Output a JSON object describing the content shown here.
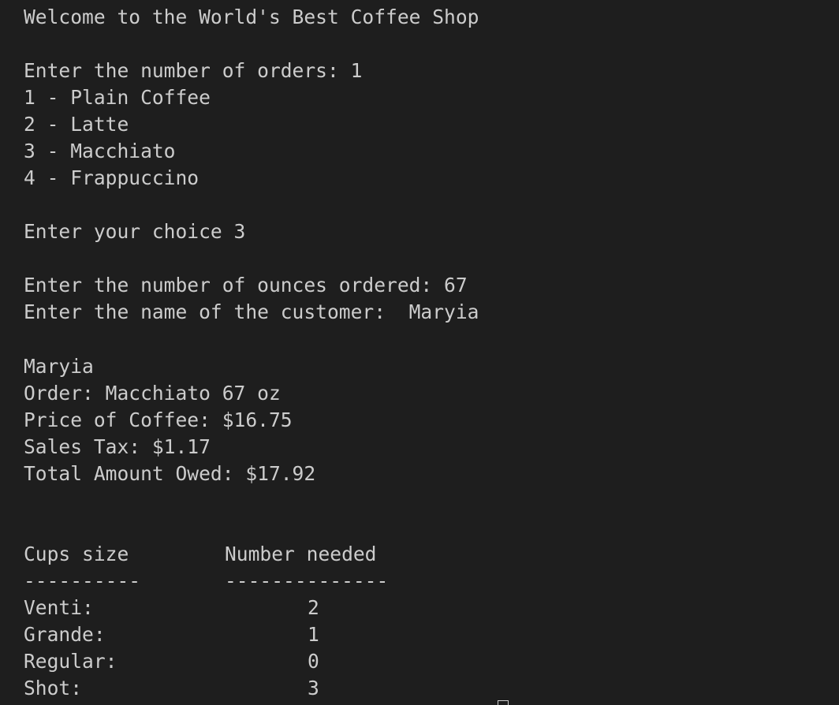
{
  "terminal": {
    "welcome": "Welcome to the World's Best Coffee Shop",
    "prompt_orders": "Enter the number of orders: 1",
    "menu": [
      "1 - Plain Coffee",
      "2 - Latte",
      "3 - Macchiato",
      "4 - Frappuccino"
    ],
    "prompt_choice": "Enter your choice 3",
    "prompt_ounces": "Enter the number of ounces ordered: 67",
    "prompt_customer": "Enter the name of the customer:  Maryia",
    "receipt": {
      "customer": "Maryia",
      "order": "Order: Macchiato 67 oz",
      "price": "Price of Coffee: $16.75",
      "tax": "Sales Tax: $1.17",
      "total": "Total Amount Owed: $17.92"
    },
    "cups_table": {
      "col1_header": "Cups size",
      "col2_header": "Number needed",
      "col1_rule": "----------",
      "col2_rule": "--------------",
      "rows": [
        {
          "size": "Venti:",
          "count": "2"
        },
        {
          "size": "Grande:",
          "count": "1"
        },
        {
          "size": "Regular:",
          "count": "0"
        },
        {
          "size": "Shot:",
          "count": "3"
        }
      ]
    },
    "colors": {
      "background": "#1e1e1e",
      "text": "#cccccc",
      "highlight": "#e5e510"
    }
  }
}
